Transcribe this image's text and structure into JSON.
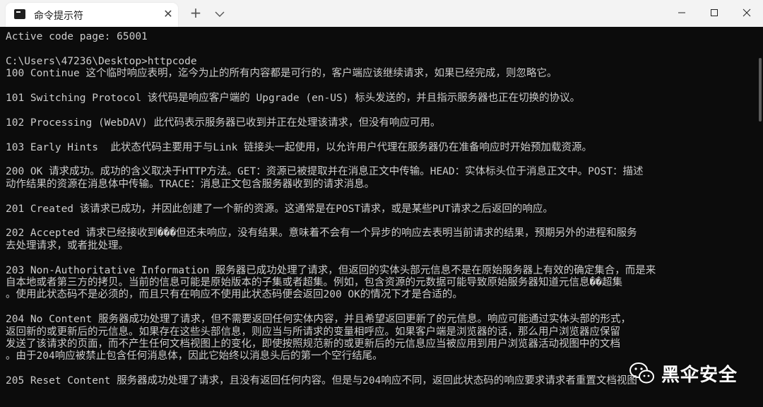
{
  "tab": {
    "title": "命令提示符",
    "close_glyph": "✕",
    "new_tab_glyph": "+"
  },
  "console": {
    "lines": [
      "Active code page: 65001",
      "",
      "C:\\Users\\47236\\Desktop>httpcode",
      "100 Continue 这个临时响应表明，迄今为止的所有内容都是可行的，客户端应该继续请求，如果已经完成，则忽略它。",
      "",
      "101 Switching Protocol 该代码是响应客户端的 Upgrade (en-US) 标头发送的，并且指示服务器也正在切换的协议。",
      "",
      "102 Processing (WebDAV) 此代码表示服务器已收到并正在处理该请求，但没有响应可用。",
      "",
      "103 Early Hints  此状态代码主要用于与Link 链接头一起使用，以允许用户代理在服务器仍在准备响应时开始预加载资源。",
      "",
      "200 OK 请求成功。成功的含义取决于HTTP方法。GET：资源已被提取并在消息正文中传输。HEAD：实体标头位于消息正文中。POST：描述",
      "动作结果的资源在消息体中传输。TRACE：消息正文包含服务器收到的请求消息。",
      "",
      "201 Created 该请求已成功，并因此创建了一个新的资源。这通常是在POST请求，或是某些PUT请求之后返回的响应。",
      "",
      "202 Accepted 请求已经接收到���但还未响应，没有结果。意味着不会有一个异步的响应去表明当前请求的结果，预期另外的进程和服务",
      "去处理请求，或者批处理。",
      "",
      "203 Non-Authoritative Information 服务器已成功处理了请求，但返回的实体头部元信息不是在原始服务器上有效的确定集合，而是来",
      "自本地或者第三方的拷贝。当前的信息可能是原始版本的子集或者超集。例如，包含资源的元数据可能导致原始服务器知道元信息��超集",
      "。使用此状态码不是必须的，而且只有在响应不使用此状态码便会返回200 OK的情况下才是合适的。",
      "",
      "204 No Content 服务器成功处理了请求，但不需要返回任何实体内容，并且希望返回更新了的元信息。响应可能通过实体头部的形式，",
      "返回新的或更新后的元信息。如果存在这些头部信息，则应当与所请求的变量相呼应。如果客户端是浏览器的话，那么用户浏览器应保留",
      "发送了该请求的页面，而不产生任何文档视图上的变化，即使按照规范新的或更新后的元信息应当被应用到用户浏览器活动视图中的文档",
      "。由于204响应被禁止包含任何消息体，因此它始终以消息头后的第一个空行结尾。",
      "",
      "205 Reset Content 服务器成功处理了请求，且没有返回任何内容。但是与204响应不同，返回此状态码的响应要求请求者重置文档视图"
    ]
  },
  "watermark": {
    "text": "黑伞安全"
  },
  "colors": {
    "console_bg": "#0c0c0c",
    "console_fg": "#cccccc",
    "titlebar_bg": "#f3f3f3"
  }
}
